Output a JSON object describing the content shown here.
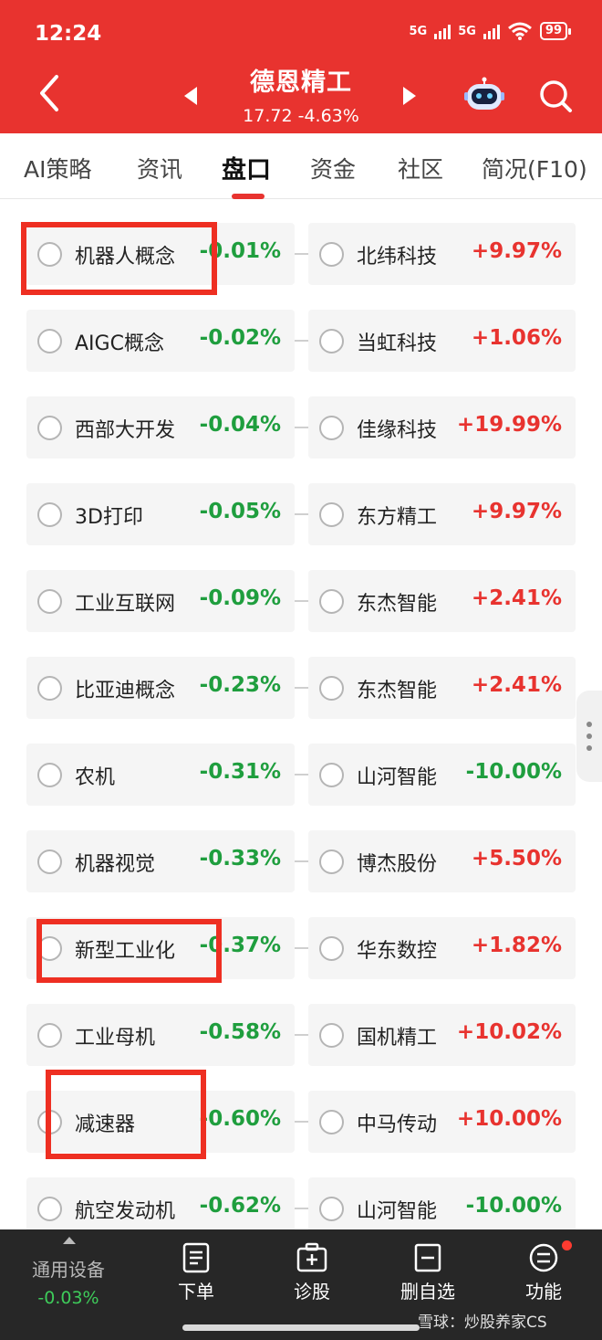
{
  "status_bar": {
    "time": "12:24",
    "sim1": "5G",
    "sim2": "5G",
    "battery": "99"
  },
  "header": {
    "title": "德恩精工",
    "price": "17.72",
    "change": "-4.63%"
  },
  "tabs": [
    {
      "label": "AI策略"
    },
    {
      "label": "资讯"
    },
    {
      "label": "盘口",
      "active": true
    },
    {
      "label": "资金"
    },
    {
      "label": "社区"
    },
    {
      "label": "简况(F10)"
    }
  ],
  "rows": [
    {
      "concept": "机器人概念",
      "concept_pct": "-0.01%",
      "stock": "北纬科技",
      "stock_pct": "+9.97%"
    },
    {
      "concept": "AIGC概念",
      "concept_pct": "-0.02%",
      "stock": "当虹科技",
      "stock_pct": "+1.06%"
    },
    {
      "concept": "西部大开发",
      "concept_pct": "-0.04%",
      "stock": "佳缘科技",
      "stock_pct": "+19.99%"
    },
    {
      "concept": "3D打印",
      "concept_pct": "-0.05%",
      "stock": "东方精工",
      "stock_pct": "+9.97%"
    },
    {
      "concept": "工业互联网",
      "concept_pct": "-0.09%",
      "stock": "东杰智能",
      "stock_pct": "+2.41%"
    },
    {
      "concept": "比亚迪概念",
      "concept_pct": "-0.23%",
      "stock": "东杰智能",
      "stock_pct": "+2.41%"
    },
    {
      "concept": "农机",
      "concept_pct": "-0.31%",
      "stock": "山河智能",
      "stock_pct": "-10.00%"
    },
    {
      "concept": "机器视觉",
      "concept_pct": "-0.33%",
      "stock": "博杰股份",
      "stock_pct": "+5.50%"
    },
    {
      "concept": "新型工业化",
      "concept_pct": "-0.37%",
      "stock": "华东数控",
      "stock_pct": "+1.82%"
    },
    {
      "concept": "工业母机",
      "concept_pct": "-0.58%",
      "stock": "国机精工",
      "stock_pct": "+10.02%"
    },
    {
      "concept": "减速器",
      "concept_pct": "-0.60%",
      "stock": "中马传动",
      "stock_pct": "+10.00%"
    },
    {
      "concept": "航空发动机",
      "concept_pct": "-0.62%",
      "stock": "山河智能",
      "stock_pct": "-10.00%"
    }
  ],
  "bottom_bar": {
    "sector": "通用设备",
    "sector_pct": "-0.03%",
    "items": [
      {
        "label": "下单",
        "icon": "order-icon"
      },
      {
        "label": "诊股",
        "icon": "diagnose-icon"
      },
      {
        "label": "删自选",
        "icon": "remove-watchlist-icon"
      },
      {
        "label": "功能",
        "icon": "menu-icon"
      }
    ]
  },
  "watermark": "雪球：炒股养家CS",
  "colors": {
    "brand_red": "#e8332f",
    "up": "#e8332f",
    "down": "#1f9e3e",
    "highlight_box": "#ee2f22"
  }
}
